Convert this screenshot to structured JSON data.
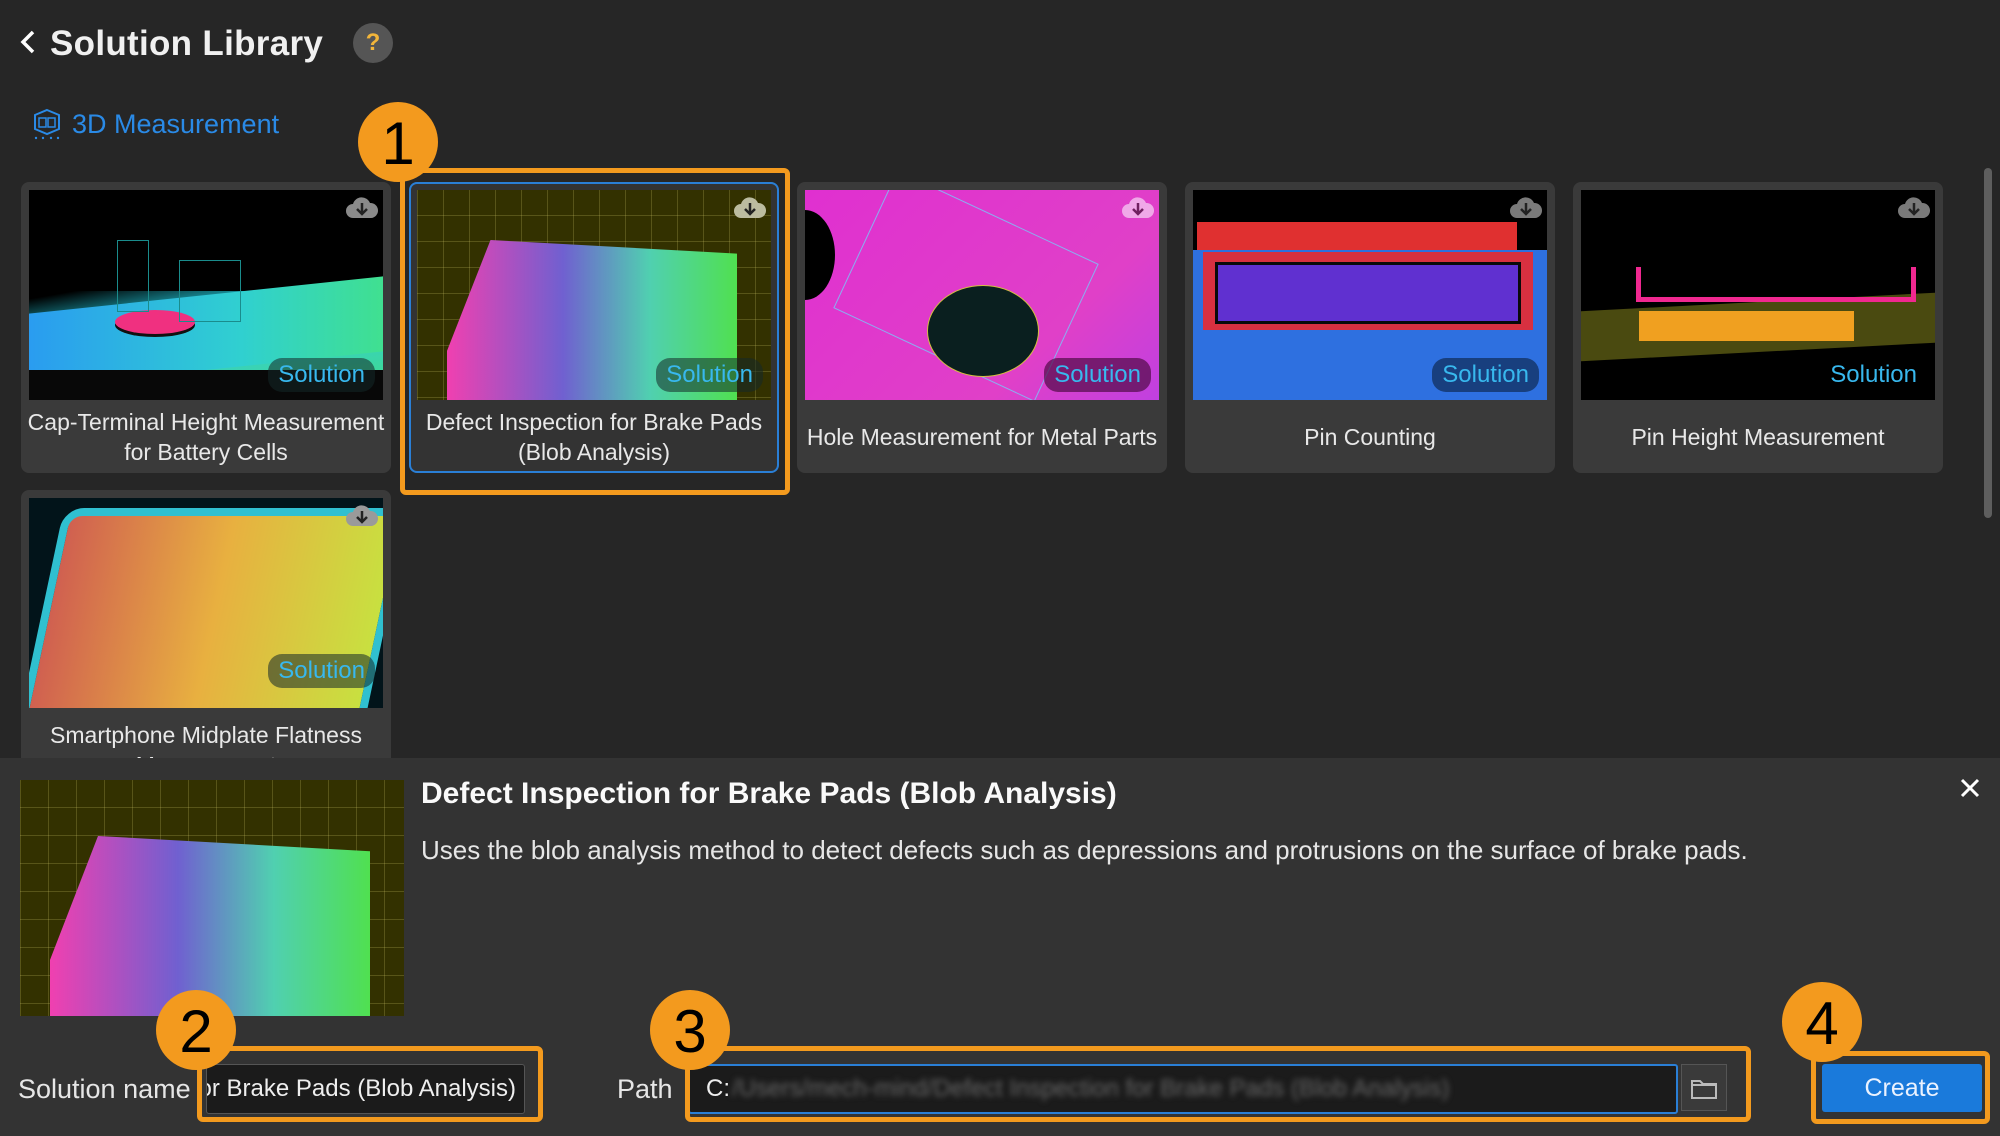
{
  "header": {
    "back_icon": "chevron-left-icon",
    "title": "Solution Library",
    "help_label": "?"
  },
  "category": {
    "icon": "3d-cube-icon",
    "label": "3D Measurement",
    "color": "#2a8ae6"
  },
  "cards": [
    {
      "title": "Cap-Terminal Height Measurement for Battery Cells",
      "badge": "Solution",
      "icon": "cloud-download-icon",
      "selected": false
    },
    {
      "title": "Defect Inspection for Brake Pads (Blob Analysis)",
      "badge": "Solution",
      "icon": "cloud-download-icon",
      "selected": true
    },
    {
      "title": "Hole Measurement for Metal Parts",
      "badge": "Solution",
      "icon": "cloud-download-icon",
      "selected": false
    },
    {
      "title": "Pin Counting",
      "badge": "Solution",
      "icon": "cloud-download-icon",
      "selected": false
    },
    {
      "title": "Pin Height Measurement",
      "badge": "Solution",
      "icon": "cloud-download-icon",
      "selected": false
    },
    {
      "title": "Smartphone Midplate Flatness Measurement",
      "badge": "Solution",
      "icon": "cloud-download-icon",
      "selected": false
    }
  ],
  "detail": {
    "title": "Defect Inspection for Brake Pads (Blob Analysis)",
    "description": "Uses the blob analysis method to detect defects such as depressions and protrusions on the surface of brake pads.",
    "close_icon": "close-icon",
    "solution_name_label": "Solution name",
    "solution_name_value": "Defect Inspection for Brake Pads (Blob Analysis)",
    "path_label": "Path",
    "path_value_visible": "C:",
    "path_value_blurred": "/Users/mech-mind/Defect Inspection for Brake Pads (Blob Analysis)",
    "browse_icon": "folder-icon",
    "create_label": "Create"
  },
  "callouts": [
    "1",
    "2",
    "3",
    "4"
  ],
  "colors": {
    "accent": "#f39a1e",
    "primary": "#1a7adb",
    "selection": "#2a7fd6",
    "background": "#262626",
    "panel": "#333333"
  }
}
